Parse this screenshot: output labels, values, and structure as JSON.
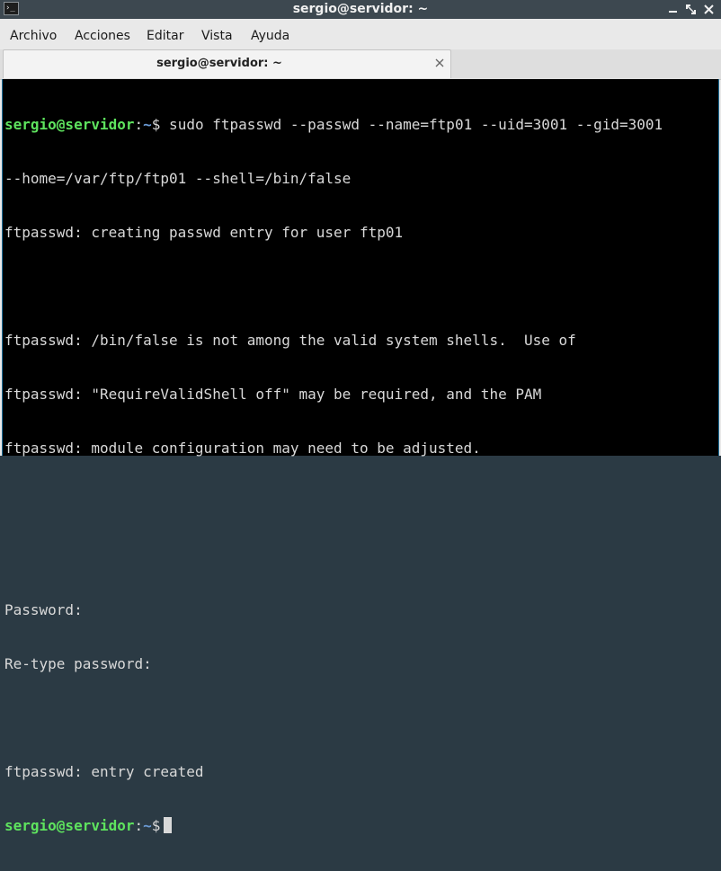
{
  "window": {
    "title": "sergio@servidor: ~",
    "title_icon_glyph": "›_"
  },
  "menu": {
    "items": [
      "Archivo",
      "Acciones",
      "Editar",
      "Vista",
      "Ayuda"
    ]
  },
  "tabs": [
    {
      "label": "sergio@servidor: ~"
    }
  ],
  "prompt": {
    "user_host": "sergio@servidor",
    "colon": ":",
    "path": "~",
    "symbol": "$"
  },
  "terminal": {
    "command1": " sudo ftpasswd --passwd --name=ftp01 --uid=3001 --gid=3001",
    "lines": [
      "--home=/var/ftp/ftp01 --shell=/bin/false",
      "ftpasswd: creating passwd entry for user ftp01",
      "",
      "ftpasswd: /bin/false is not among the valid system shells.  Use of",
      "ftpasswd: \"RequireValidShell off\" may be required, and the PAM",
      "ftpasswd: module configuration may need to be adjusted.",
      "",
      "",
      "Password:",
      "Re-type password:",
      "",
      "ftpasswd: entry created"
    ]
  },
  "colors": {
    "prompt_user": "#5ee35e",
    "prompt_path": "#6b9bd6",
    "terminal_bg": "#000000",
    "terminal_fg": "#d9d9d9",
    "titlebar_bg": "#3d4850"
  }
}
